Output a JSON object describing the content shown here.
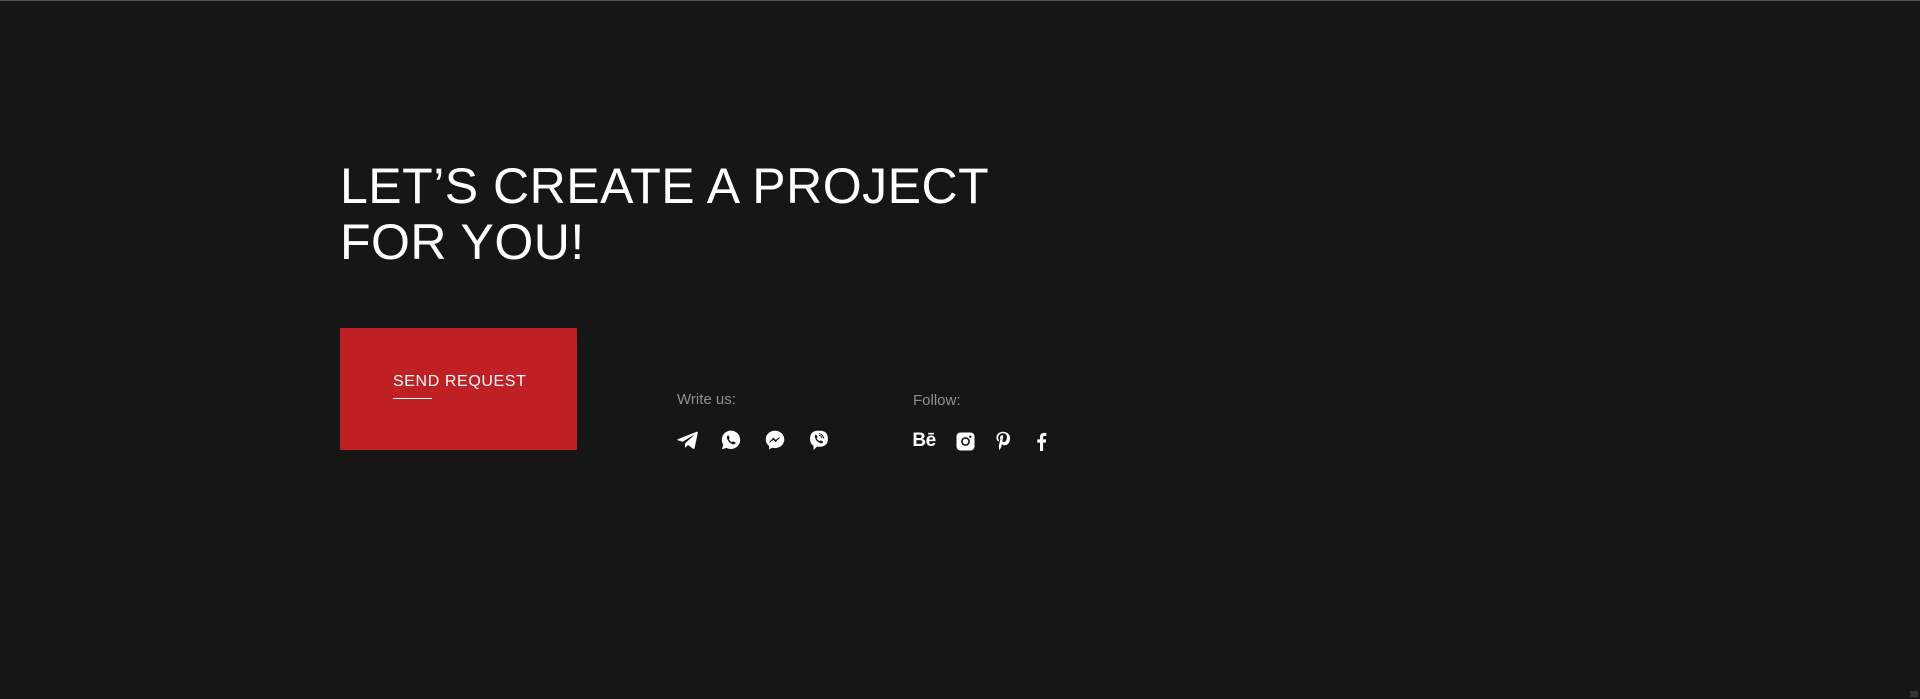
{
  "hero": {
    "heading_line1": "LET’S CREATE A PROJECT",
    "heading_line2": "FOR YOU!"
  },
  "cta": {
    "label": "SEND REQUEST"
  },
  "contact": {
    "write_label": "Write us:",
    "write_icons": [
      "telegram-icon",
      "whatsapp-icon",
      "messenger-icon",
      "viber-icon"
    ]
  },
  "social": {
    "follow_label": "Follow:",
    "behance_text": "Bē",
    "follow_icons": [
      "behance-icon",
      "instagram-icon",
      "pinterest-icon",
      "facebook-icon"
    ]
  },
  "colors": {
    "background": "#161616",
    "accent": "#be2024",
    "text": "#ffffff",
    "muted_text": "#8f8f8f"
  }
}
